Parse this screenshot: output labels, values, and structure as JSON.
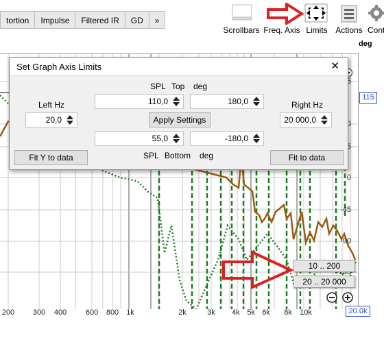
{
  "tabs": [
    "tortion",
    "Impulse",
    "Filtered IR",
    "GD",
    "»"
  ],
  "toolbar": {
    "scrollbars": "Scrollbars",
    "freq_axis": "Freq. Axis",
    "limits": "Limits",
    "actions": "Actions",
    "controls": "Cont"
  },
  "graph": {
    "right_axis_unit": "deg",
    "right_ticks": [
      "135",
      "115",
      "90",
      "45",
      "0",
      "-45",
      "-90",
      "-135"
    ],
    "x_ticks": [
      "200",
      "300",
      "400",
      "600",
      "800",
      "1k",
      "2k",
      "3k",
      "4k",
      "5k",
      "6k",
      "8k",
      "10k",
      "20.0k"
    ],
    "range_buttons": [
      "10 .. 200",
      "20 .. 20 000"
    ],
    "zoom_out": "−",
    "zoom_in": "+"
  },
  "dialog": {
    "title": "Set Graph Axis Limits",
    "close": "✕",
    "top_label": {
      "spl": "SPL",
      "pos": "Top",
      "deg": "deg"
    },
    "bottom_label": {
      "spl": "SPL",
      "pos": "Bottom",
      "deg": "deg"
    },
    "left_hz_label": "Left Hz",
    "right_hz_label": "Right Hz",
    "left_hz": "20,0",
    "right_hz": "20 000,0",
    "spl_top": "110,0",
    "deg_top": "180,0",
    "spl_bottom": "55,0",
    "deg_bottom": "-180,0",
    "apply": "Apply Settings",
    "fit_y": "Fit Y to data",
    "fit_data": "Fit to data"
  },
  "colors": {
    "spl_trace": "#9c5a12",
    "phase_trace": "#1e7a1e",
    "annotation": "#e02020"
  }
}
